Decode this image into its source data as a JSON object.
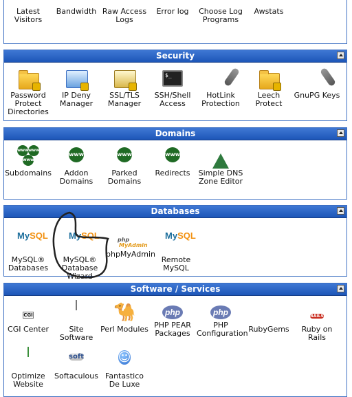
{
  "top_row": [
    {
      "label": "Latest Visitors",
      "icon": "visitors-icon"
    },
    {
      "label": "Bandwidth",
      "icon": "bandwidth-icon"
    },
    {
      "label": "Raw Access Logs",
      "icon": "raw-logs-icon"
    },
    {
      "label": "Error log",
      "icon": "error-log-icon"
    },
    {
      "label": "Choose Log Programs",
      "icon": "log-programs-icon"
    },
    {
      "label": "Awstats",
      "icon": "awstats-icon"
    }
  ],
  "security": {
    "title": "Security",
    "items": [
      {
        "label": "Password Protect Directories",
        "icon": "password-folder-icon"
      },
      {
        "label": "IP Deny Manager",
        "icon": "ip-deny-icon"
      },
      {
        "label": "SSL/TLS Manager",
        "icon": "ssl-icon"
      },
      {
        "label": "SSH/Shell Access",
        "icon": "terminal-icon"
      },
      {
        "label": "HotLink Protection",
        "icon": "hotlink-icon"
      },
      {
        "label": "Leech Protect",
        "icon": "leech-folder-icon"
      },
      {
        "label": "GnuPG Keys",
        "icon": "key-icon"
      }
    ]
  },
  "domains": {
    "title": "Domains",
    "items": [
      {
        "label": "Subdomains",
        "icon": "subdomains-icon"
      },
      {
        "label": "Addon Domains",
        "icon": "addon-domains-icon"
      },
      {
        "label": "Parked Domains",
        "icon": "parked-domains-icon"
      },
      {
        "label": "Redirects",
        "icon": "redirects-icon"
      },
      {
        "label": "Simple DNS Zone Editor",
        "icon": "dns-zone-icon"
      }
    ]
  },
  "databases": {
    "title": "Databases",
    "items": [
      {
        "label": "MySQL® Databases",
        "icon": "mysql-icon"
      },
      {
        "label": "MySQL® Database Wizard",
        "icon": "mysql-wizard-icon"
      },
      {
        "label": "phpMyAdmin",
        "icon": "phpmyadmin-icon"
      },
      {
        "label": "Remote MySQL",
        "icon": "remote-mysql-icon"
      }
    ]
  },
  "software": {
    "title": "Software / Services",
    "items": [
      {
        "label": "CGI Center",
        "icon": "cgi-icon"
      },
      {
        "label": "Site Software",
        "icon": "site-software-icon"
      },
      {
        "label": "Perl Modules",
        "icon": "camel-icon"
      },
      {
        "label": "PHP PEAR Packages",
        "icon": "php-pear-icon"
      },
      {
        "label": "PHP Configuration",
        "icon": "php-config-icon"
      },
      {
        "label": "RubyGems",
        "icon": "rubygems-icon"
      },
      {
        "label": "Ruby on Rails",
        "icon": "rails-icon"
      },
      {
        "label": "Optimize Website",
        "icon": "optimize-icon"
      },
      {
        "label": "Softaculous",
        "icon": "softaculous-icon"
      },
      {
        "label": "Fantastico De Luxe",
        "icon": "fantastico-icon"
      }
    ]
  },
  "icon_text": {
    "terminal": "$_",
    "www": "www",
    "mysql_a": "My",
    "mysql_b": "SQL",
    "php": "php",
    "myadmin": "MyAdmin",
    "cgi": "CGI",
    "soft": "soft",
    "rails": "RAILS"
  },
  "colors": {
    "header_bg": "#2a63c6",
    "panel_border": "#3c6fc2",
    "header_text": "#ffffff"
  }
}
